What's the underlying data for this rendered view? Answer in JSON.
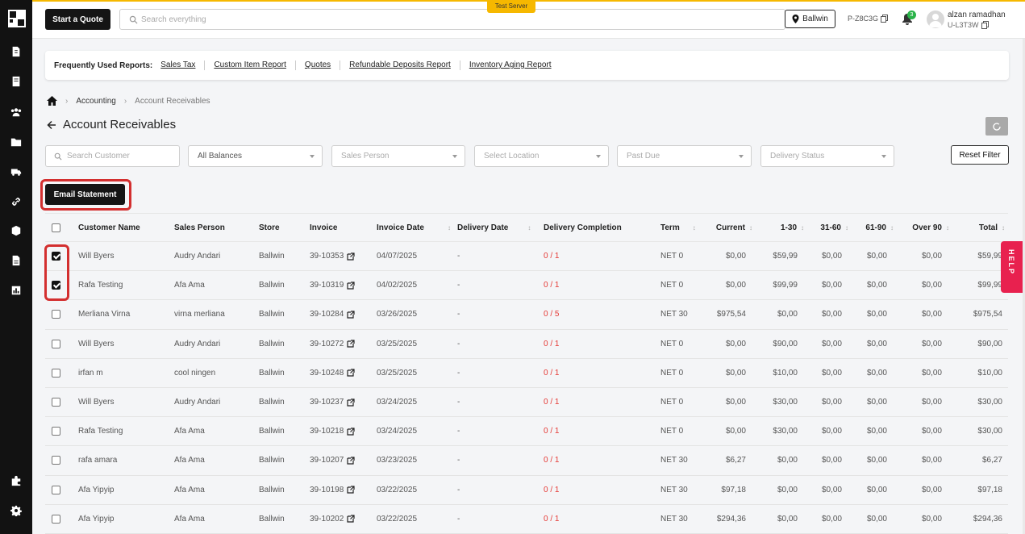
{
  "header": {
    "quote_button": "Start a Quote",
    "search_placeholder": "Search everything",
    "server_badge": "Test Server",
    "location": "Ballwin",
    "store_code": "P-Z8C3G",
    "notifications": "3",
    "user_name": "alzan ramadhan",
    "user_id": "U-L3T3W"
  },
  "reports": {
    "label": "Frequently Used Reports:",
    "links": [
      "Sales Tax",
      "Custom Item Report",
      "Quotes",
      "Refundable Deposits Report",
      "Inventory Aging Report"
    ]
  },
  "breadcrumb": {
    "section": "Accounting",
    "current": "Account Receivables"
  },
  "page_title": "Account Receivables",
  "filters": {
    "search_customer": "Search Customer",
    "balances": "All Balances",
    "sales_person": "Sales Person",
    "location": "Select Location",
    "past_due": "Past Due",
    "delivery_status": "Delivery Status",
    "reset": "Reset Filter"
  },
  "email_statement": "Email Statement",
  "columns": [
    "Customer Name",
    "Sales Person",
    "Store",
    "Invoice",
    "Invoice Date",
    "Delivery Date",
    "Delivery Completion",
    "Term",
    "Current",
    "1-30",
    "31-60",
    "61-90",
    "Over 90",
    "Total"
  ],
  "rows": [
    {
      "checked": true,
      "customer": "Will Byers",
      "sales": "Audry Andari",
      "store": "Ballwin",
      "invoice": "39-10353",
      "date": "04/07/2025",
      "delivery": "-",
      "completion": "0 / 1",
      "term": "NET 0",
      "current": "$0,00",
      "d30": "$59,99",
      "d60": "$0,00",
      "d90": "$0,00",
      "over": "$0,00",
      "total": "$59,99"
    },
    {
      "checked": true,
      "customer": "Rafa Testing",
      "sales": "Afa Ama",
      "store": "Ballwin",
      "invoice": "39-10319",
      "date": "04/02/2025",
      "delivery": "-",
      "completion": "0 / 1",
      "term": "NET 0",
      "current": "$0,00",
      "d30": "$99,99",
      "d60": "$0,00",
      "d90": "$0,00",
      "over": "$0,00",
      "total": "$99,99"
    },
    {
      "checked": false,
      "customer": "Merliana Virna",
      "sales": "virna merliana",
      "store": "Ballwin",
      "invoice": "39-10284",
      "date": "03/26/2025",
      "delivery": "-",
      "completion": "0 / 5",
      "term": "NET 30",
      "current": "$975,54",
      "d30": "$0,00",
      "d60": "$0,00",
      "d90": "$0,00",
      "over": "$0,00",
      "total": "$975,54"
    },
    {
      "checked": false,
      "customer": "Will Byers",
      "sales": "Audry Andari",
      "store": "Ballwin",
      "invoice": "39-10272",
      "date": "03/25/2025",
      "delivery": "-",
      "completion": "0 / 1",
      "term": "NET 0",
      "current": "$0,00",
      "d30": "$90,00",
      "d60": "$0,00",
      "d90": "$0,00",
      "over": "$0,00",
      "total": "$90,00"
    },
    {
      "checked": false,
      "customer": "irfan m",
      "sales": "cool ningen",
      "store": "Ballwin",
      "invoice": "39-10248",
      "date": "03/25/2025",
      "delivery": "-",
      "completion": "0 / 1",
      "term": "NET 0",
      "current": "$0,00",
      "d30": "$10,00",
      "d60": "$0,00",
      "d90": "$0,00",
      "over": "$0,00",
      "total": "$10,00"
    },
    {
      "checked": false,
      "customer": "Will Byers",
      "sales": "Audry Andari",
      "store": "Ballwin",
      "invoice": "39-10237",
      "date": "03/24/2025",
      "delivery": "-",
      "completion": "0 / 1",
      "term": "NET 0",
      "current": "$0,00",
      "d30": "$30,00",
      "d60": "$0,00",
      "d90": "$0,00",
      "over": "$0,00",
      "total": "$30,00"
    },
    {
      "checked": false,
      "customer": "Rafa Testing",
      "sales": "Afa Ama",
      "store": "Ballwin",
      "invoice": "39-10218",
      "date": "03/24/2025",
      "delivery": "-",
      "completion": "0 / 1",
      "term": "NET 0",
      "current": "$0,00",
      "d30": "$30,00",
      "d60": "$0,00",
      "d90": "$0,00",
      "over": "$0,00",
      "total": "$30,00"
    },
    {
      "checked": false,
      "customer": "rafa amara",
      "sales": "Afa Ama",
      "store": "Ballwin",
      "invoice": "39-10207",
      "date": "03/23/2025",
      "delivery": "-",
      "completion": "0 / 1",
      "term": "NET 30",
      "current": "$6,27",
      "d30": "$0,00",
      "d60": "$0,00",
      "d90": "$0,00",
      "over": "$0,00",
      "total": "$6,27"
    },
    {
      "checked": false,
      "customer": "Afa Yipyip",
      "sales": "Afa Ama",
      "store": "Ballwin",
      "invoice": "39-10198",
      "date": "03/22/2025",
      "delivery": "-",
      "completion": "0 / 1",
      "term": "NET 30",
      "current": "$97,18",
      "d30": "$0,00",
      "d60": "$0,00",
      "d90": "$0,00",
      "over": "$0,00",
      "total": "$97,18"
    },
    {
      "checked": false,
      "customer": "Afa Yipyip",
      "sales": "Afa Ama",
      "store": "Ballwin",
      "invoice": "39-10202",
      "date": "03/22/2025",
      "delivery": "-",
      "completion": "0 / 1",
      "term": "NET 30",
      "current": "$294,36",
      "d30": "$0,00",
      "d60": "$0,00",
      "d90": "$0,00",
      "over": "$0,00",
      "total": "$294,36"
    }
  ],
  "help_label": "HELP",
  "colors": {
    "accent": "#f6b800",
    "danger": "#e53935",
    "help": "#e8214f",
    "sidebar": "#121212"
  }
}
